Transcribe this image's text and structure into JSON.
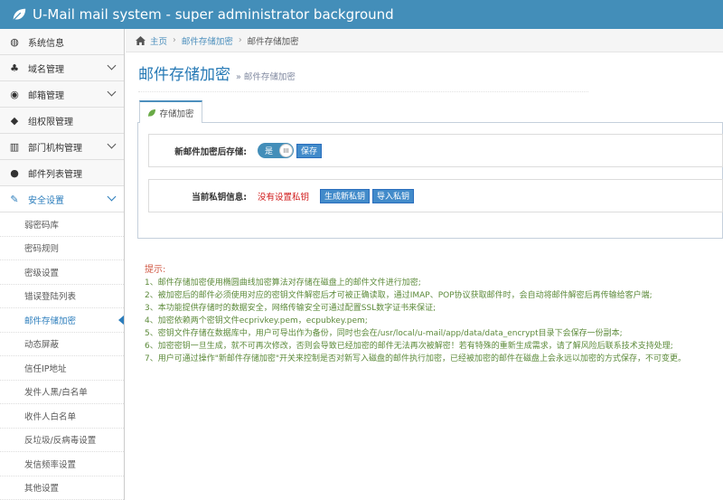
{
  "app": {
    "title": "U-Mail mail system - super administrator background"
  },
  "sidebar": {
    "items": [
      {
        "label": "系统信息",
        "icon": "dashboard-icon",
        "glyph": "◍",
        "has_chevron": false
      },
      {
        "label": "域名管理",
        "icon": "sitemap-icon",
        "glyph": "♣",
        "has_chevron": true
      },
      {
        "label": "邮箱管理",
        "icon": "globe-icon",
        "glyph": "◉",
        "has_chevron": true
      },
      {
        "label": "组权限管理",
        "icon": "tags-icon",
        "glyph": "◆",
        "has_chevron": false
      },
      {
        "label": "部门机构管理",
        "icon": "bar-chart-icon",
        "glyph": "▥",
        "has_chevron": true
      },
      {
        "label": "邮件列表管理",
        "icon": "user-icon",
        "glyph": "●",
        "has_chevron": false
      }
    ],
    "open_item": {
      "label": "安全设置",
      "icon": "wrench-icon",
      "glyph": "✎"
    },
    "sub_items": [
      "弱密码库",
      "密码规则",
      "密级设置",
      "错误登陆列表",
      "邮件存储加密",
      "动态屏蔽",
      "信任IP地址",
      "发件人黑/白名单",
      "收件人白名单",
      "反垃圾/反病毒设置",
      "发信频率设置",
      "其他设置"
    ],
    "active_sub_index": 4
  },
  "breadcrumb": {
    "home": "主页",
    "level1": "邮件存储加密",
    "current": "邮件存储加密"
  },
  "page": {
    "title": "邮件存储加密",
    "subtitle": "» 邮件存储加密"
  },
  "tab": {
    "label": "存储加密"
  },
  "form": {
    "encrypt_row": {
      "label": "新邮件加密后存储:",
      "toggle_text": "是",
      "toggle_on": true,
      "save_label": "保存"
    },
    "key_row": {
      "label": "当前私钥信息:",
      "status": "没有设置私钥",
      "generate_label": "生成新私钥",
      "import_label": "导入私钥"
    }
  },
  "tips": {
    "title": "提示:",
    "lines": [
      "1、邮件存储加密使用椭圆曲线加密算法对存储在磁盘上的邮件文件进行加密;",
      "2、被加密后的邮件必须使用对应的密钥文件解密后才可被正确读取，通过IMAP、POP协议获取邮件时，会自动将邮件解密后再传输给客户端;",
      "3、本功能提供存储时的数据安全，网络传输安全可通过配置SSL数字证书来保证;",
      "4、加密依赖两个密钥文件ecprivkey.pem，ecpubkey.pem;",
      "5、密钥文件存储在数据库中，用户可导出作为备份，同时也会在/usr/local/u-mail/app/data/data_encrypt目录下会保存一份副本;",
      "6、加密密钥一旦生成，就不可再次修改，否则会导致已经加密的邮件无法再次被解密！若有特殊的重新生成需求，请了解风险后联系技术支持处理;",
      "7、用户可通过操作\"新邮件存储加密\"开关来控制是否对新写入磁盘的邮件执行加密，已经被加密的邮件在磁盘上会永远以加密的方式保存，不可变更。"
    ]
  },
  "colors": {
    "topbar": "#438eb9",
    "accent": "#2b7dbc",
    "button": "#428bca",
    "danger": "#d01a1a",
    "tips_title": "#d15b47",
    "tips_text": "#5c8a3a"
  }
}
